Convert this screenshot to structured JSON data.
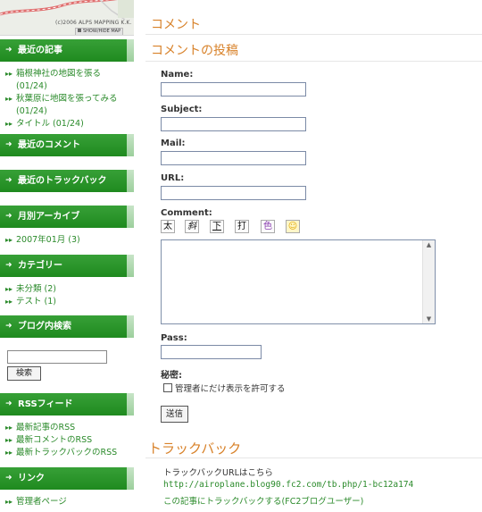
{
  "map": {
    "copyright": "(c)2006 ALPS MAPPING K.K.",
    "show_hide": "SHOW/HIDE MAP"
  },
  "sidebar": {
    "recent_posts": {
      "title": "最近の記事",
      "items": [
        {
          "text": "箱根神社の地図を張る",
          "sub": "(01/24)"
        },
        {
          "text": "秋葉原に地図を張ってみる",
          "sub": "(01/24)"
        },
        {
          "text": "タイトル (01/24)",
          "sub": ""
        }
      ]
    },
    "recent_comments": {
      "title": "最近のコメント"
    },
    "recent_trackbacks": {
      "title": "最近のトラックバック"
    },
    "archives": {
      "title": "月別アーカイブ",
      "items": [
        "2007年01月 (3)"
      ]
    },
    "categories": {
      "title": "カテゴリー",
      "items": [
        "未分類 (2)",
        "テスト (1)"
      ]
    },
    "blog_search": {
      "title": "ブログ内検索",
      "button": "検索",
      "value": ""
    },
    "rss": {
      "title": "RSSフィード",
      "items": [
        "最新記事のRSS",
        "最新コメントのRSS",
        "最新トラックバックのRSS"
      ]
    },
    "links": {
      "title": "リンク",
      "items": [
        "管理者ページ"
      ]
    }
  },
  "main": {
    "comment_heading": "コメント",
    "post_heading": "コメントの投稿",
    "form": {
      "name_label": "Name:",
      "subject_label": "Subject:",
      "mail_label": "Mail:",
      "url_label": "URL:",
      "comment_label": "Comment:",
      "pass_label": "Pass:",
      "secret_label": "秘密:",
      "secret_checkbox": "管理者にだけ表示を許可する",
      "submit": "送信",
      "name_value": "",
      "subject_value": "",
      "mail_value": "",
      "url_value": "",
      "pass_value": "",
      "toolbar": [
        {
          "icon": "bold-icon",
          "glyph": "太"
        },
        {
          "icon": "italic-icon",
          "glyph": "斜"
        },
        {
          "icon": "underline-icon",
          "glyph": "下"
        },
        {
          "icon": "strike-icon",
          "glyph": "打"
        },
        {
          "icon": "color-icon",
          "glyph": "色"
        },
        {
          "icon": "emoji-icon",
          "glyph": "☺"
        }
      ]
    },
    "trackback": {
      "heading": "トラックバック",
      "intro": "トラックバックURLはこちら",
      "url": "http://airoplane.blog90.fc2.com/tb.php/1-bc12a174",
      "link": "この記事にトラックバックする(FC2ブログユーザー)"
    }
  }
}
